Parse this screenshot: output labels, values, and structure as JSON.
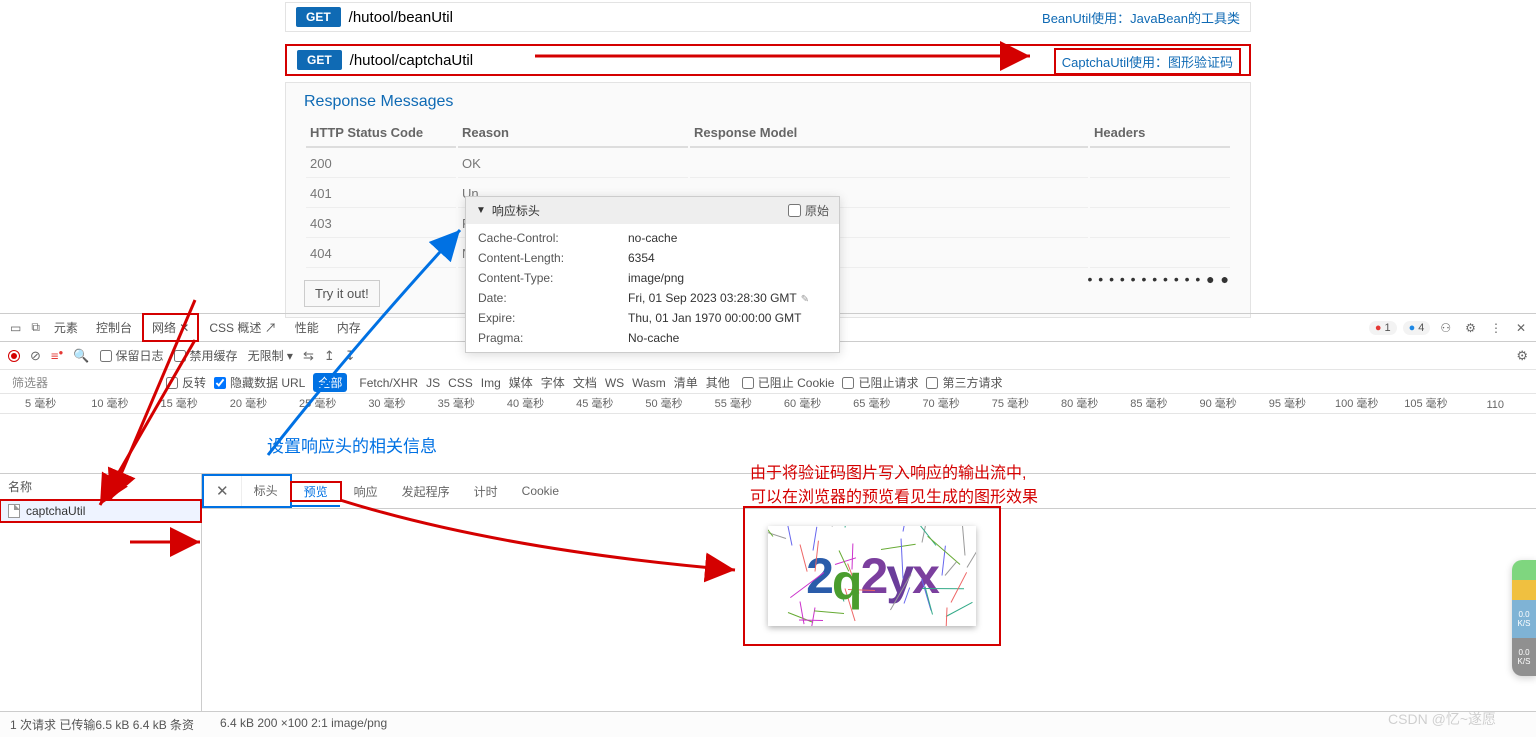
{
  "api1": {
    "method": "GET",
    "path": "/hutool/beanUtil",
    "desc": "BeanUtil使用：JavaBean的工具类"
  },
  "api2": {
    "method": "GET",
    "path": "/hutool/captchaUtil",
    "desc": "CaptchaUtil使用：图形验证码"
  },
  "resp": {
    "title": "Response Messages",
    "cols": [
      "HTTP Status Code",
      "Reason",
      "Response Model",
      "Headers"
    ],
    "rows": [
      {
        "code": "200",
        "reason": "OK"
      },
      {
        "code": "401",
        "reason": "Un"
      },
      {
        "code": "403",
        "reason": "For"
      },
      {
        "code": "404",
        "reason": "No"
      }
    ],
    "try": "Try it out!"
  },
  "hdr": {
    "title": "响应标头",
    "raw": "原始",
    "rows": [
      {
        "k": "Cache-Control:",
        "v": "no-cache"
      },
      {
        "k": "Content-Length:",
        "v": "6354"
      },
      {
        "k": "Content-Type:",
        "v": "image/png"
      },
      {
        "k": "Date:",
        "v": "Fri, 01 Sep 2023 03:28:30 GMT",
        "edit": true
      },
      {
        "k": "Expire:",
        "v": "Thu, 01 Jan 1970 00:00:00 GMT"
      },
      {
        "k": "Pragma:",
        "v": "No-cache"
      }
    ]
  },
  "devtabs": [
    "元素",
    "控制台",
    "网络",
    "CSS 概述",
    "性能",
    "内存"
  ],
  "devbadges": {
    "errors": "1",
    "msgs": "4"
  },
  "toolbar": {
    "keep": "保留日志",
    "cache": "禁用缓存",
    "throttle": "无限制"
  },
  "filter": {
    "placeholder": "筛选器",
    "invert": "反转",
    "hide": "隐藏数据 URL",
    "all": "全部",
    "types": [
      "Fetch/XHR",
      "JS",
      "CSS",
      "Img",
      "媒体",
      "字体",
      "文档",
      "WS",
      "Wasm",
      "清单",
      "其他"
    ],
    "blocked": "已阻止 Cookie",
    "blockedReq": "已阻止请求",
    "third": "第三方请求"
  },
  "timeline": [
    "5 毫秒",
    "10 毫秒",
    "15 毫秒",
    "20 毫秒",
    "25 毫秒",
    "30 毫秒",
    "35 毫秒",
    "40 毫秒",
    "45 毫秒",
    "50 毫秒",
    "55 毫秒",
    "60 毫秒",
    "65 毫秒",
    "70 毫秒",
    "75 毫秒",
    "80 毫秒",
    "85 毫秒",
    "90 毫秒",
    "95 毫秒",
    "100 毫秒",
    "105 毫秒",
    "110"
  ],
  "requests": {
    "hdr": "名称",
    "items": [
      "captchaUtil"
    ]
  },
  "detailtabs": {
    "close": "✕",
    "tabs": [
      "标头",
      "预览",
      "响应",
      "发起程序",
      "计时",
      "Cookie"
    ]
  },
  "annotations": {
    "blue": "设置响应头的相关信息",
    "red": "由于将验证码图片写入响应的输出流中,\n可以在浏览器的预览看见生成的图形效果"
  },
  "captcha": "2q2yx",
  "status": {
    "left": "1 次请求  已传输6.5 kB  6.4 kB 条资",
    "right": "6.4 kB  200 ×100  2:1  image/png"
  },
  "watermark": "CSDN @忆~遂愿"
}
